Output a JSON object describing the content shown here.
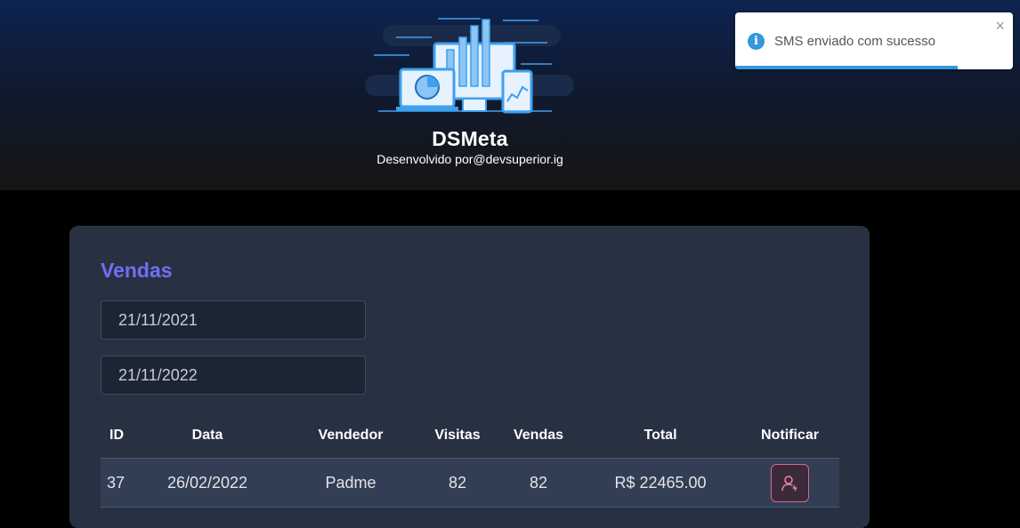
{
  "header": {
    "title": "DSMeta",
    "subtitle": "Desenvolvido por@devsuperior.ig"
  },
  "toast": {
    "message": "SMS enviado com sucesso",
    "close_label": "×",
    "progress": 0.8,
    "icon": "info-icon",
    "accent": "#3498db"
  },
  "sales": {
    "title": "Vendas",
    "min_date": "21/11/2021",
    "max_date": "21/11/2022",
    "columns": {
      "id": "ID",
      "date": "Data",
      "seller": "Vendedor",
      "visits": "Visitas",
      "deals": "Vendas",
      "total": "Total",
      "notify": "Notificar"
    },
    "rows": [
      {
        "id": "37",
        "date": "26/02/2022",
        "seller": "Padme",
        "visits": "82",
        "deals": "82",
        "total": "R$ 22465.00"
      }
    ]
  },
  "colors": {
    "accent_title": "#6f6ff5",
    "notify_border": "#d46a8a"
  }
}
